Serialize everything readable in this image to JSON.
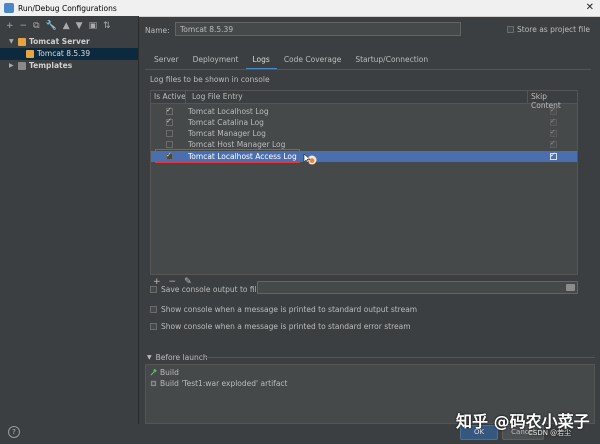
{
  "window": {
    "title": "Run/Debug Configurations"
  },
  "sidebar": {
    "toolbar": [
      "+",
      "−",
      "⧉",
      "🔧",
      "▲",
      "▼",
      "▣",
      "⇅"
    ],
    "tree": [
      {
        "label": "Tomcat Server",
        "expanded": true
      },
      {
        "label": "Tomcat 8.5.39",
        "selected": true
      },
      {
        "label": "Templates",
        "expanded": false
      }
    ]
  },
  "config": {
    "name_label": "Name:",
    "name_value": "Tomcat 8.5.39",
    "store_label": "Store as project file"
  },
  "tabs": [
    "Server",
    "Deployment",
    "Logs",
    "Code Coverage",
    "Startup/Connection"
  ],
  "logs": {
    "title": "Log files to be shown in console",
    "headers": {
      "active": "Is Active",
      "entry": "Log File Entry",
      "skip": "Skip Content"
    },
    "rows": [
      {
        "entry": "Tomcat Localhost Log",
        "active": true,
        "skip": true
      },
      {
        "entry": "Tomcat Catalina Log",
        "active": true,
        "skip": true
      },
      {
        "entry": "Tomcat Manager Log",
        "active": false,
        "skip": true
      },
      {
        "entry": "Tomcat Host Manager Log",
        "active": false,
        "skip": true
      },
      {
        "entry": "Tomcat Localhost Access Log",
        "active": true,
        "skip": true,
        "selected": true
      }
    ],
    "toolbar": [
      "+",
      "−",
      "✎"
    ]
  },
  "options": {
    "save_output": "Save console output to file:",
    "show_stdout": "Show console when a message is printed to standard output stream",
    "show_stderr": "Show console when a message is printed to standard error stream"
  },
  "before_launch": {
    "title": "Before launch",
    "items": [
      "Build",
      "Build 'Test1:war exploded' artifact"
    ]
  },
  "buttons": {
    "help": "?",
    "ok": "OK",
    "cancel": "Cancel"
  },
  "watermark": {
    "main": "知乎 @码农小菜子",
    "sub": "CSDN @若尘"
  },
  "colors": {
    "accent": "#4b6eaf",
    "highlight_box": "#e0393e",
    "background": "#3c3f41"
  }
}
